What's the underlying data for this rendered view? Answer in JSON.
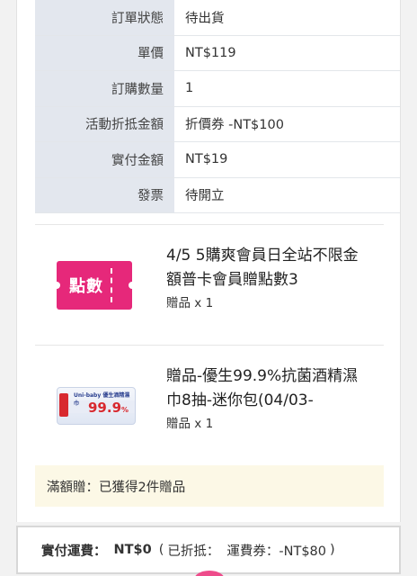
{
  "order": {
    "rows": [
      {
        "label": "訂單狀態",
        "value": "待出貨"
      },
      {
        "label": "單價",
        "value": "NT$119"
      },
      {
        "label": "訂購數量",
        "value": "1"
      },
      {
        "label": "活動折抵金額",
        "value": "折價券 -NT$100"
      },
      {
        "label": "實付金額",
        "value": "NT$19"
      },
      {
        "label": "發票",
        "value": "待開立"
      }
    ]
  },
  "gifts": [
    {
      "title": "4/5 5購爽會員日全站不限金額普卡會員贈點數3",
      "qty": "贈品 x 1",
      "badge_text": "點數",
      "icon": "points-coupon-icon"
    },
    {
      "title": "贈品-優生99.9%抗菌酒精濕巾8抽-迷你包(04/03-",
      "qty": "贈品 x 1",
      "thumb_brand": "Uni-baby 優生酒精濕巾",
      "thumb_pct": "99.9",
      "thumb_pct_unit": "%",
      "icon": "wet-wipes-product-image"
    }
  ],
  "promo": {
    "text": "滿額贈：已獲得2件贈品"
  },
  "shipping": {
    "label": "實付運費：",
    "amount": "NT$0",
    "detail_open": "(",
    "detail_label": "已折抵：",
    "detail_value": "運費券：-NT$80",
    "detail_close": ")"
  },
  "colors": {
    "label_bg": "#e3e7ee",
    "points_badge": "#e6287a",
    "promo_bg": "#fcf8e6"
  }
}
